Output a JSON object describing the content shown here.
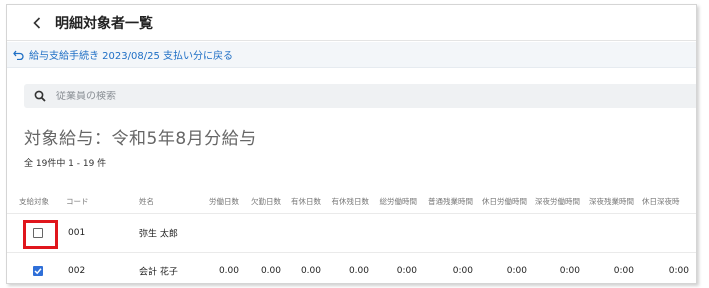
{
  "header": {
    "title": "明細対象者一覧"
  },
  "subbar": {
    "back_link_label": "給与支給手続き 2023/08/25 支払い分に戻る"
  },
  "search": {
    "placeholder": "従業員の検索"
  },
  "target": {
    "title": "対象給与：令和5年8月分給与",
    "count_label": "全 19件中 1 - 19 件"
  },
  "table": {
    "columns": [
      "支給対象",
      "コード",
      "姓名",
      "労働日数",
      "欠勤日数",
      "有休日数",
      "有休残日数",
      "総労働時間",
      "普通残業時間",
      "休日労働時間",
      "深夜労働時間",
      "深夜残業時間",
      "休日深夜時"
    ],
    "rows": [
      {
        "checked": false,
        "code": "001",
        "name": "弥生 太郎",
        "values": [
          "",
          "",
          "",
          "",
          "",
          "",
          "",
          "",
          "",
          ""
        ]
      },
      {
        "checked": true,
        "code": "002",
        "name": "会計 花子",
        "values": [
          "0.00",
          "0.00",
          "0.00",
          "0.00",
          "0:00",
          "0:00",
          "0:00",
          "0:00",
          "0:00",
          "0:00"
        ]
      }
    ]
  },
  "colors": {
    "accent": "#1f6fc5",
    "checkbox_checked": "#2f6fd8",
    "highlight": "#e0161c"
  },
  "icons": {
    "back": "chevron-left-icon",
    "return": "return-arrow-icon",
    "search": "search-icon"
  }
}
